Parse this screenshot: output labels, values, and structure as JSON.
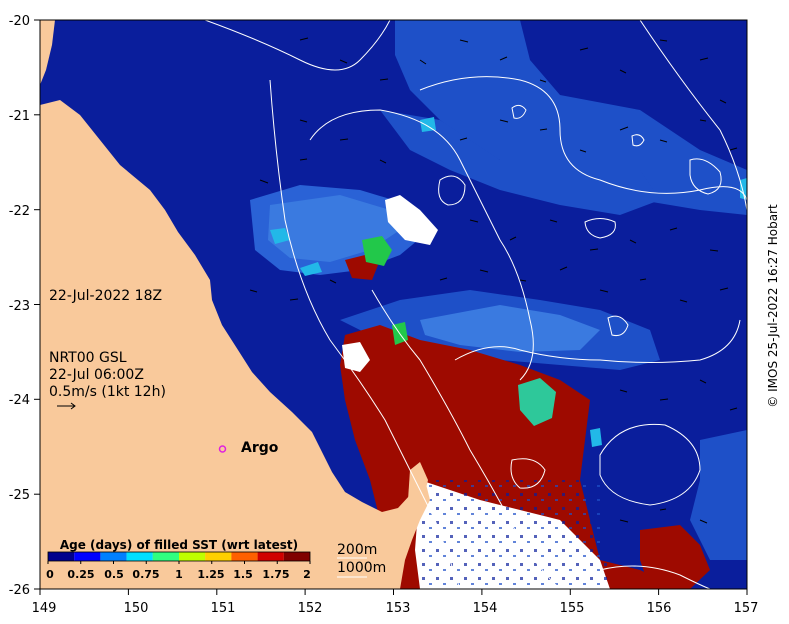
{
  "map": {
    "x_ticks": [
      "149",
      "150",
      "151",
      "152",
      "153",
      "154",
      "155",
      "156",
      "157"
    ],
    "y_ticks": [
      "-20",
      "-21",
      "-22",
      "-23",
      "-24",
      "-25",
      "-26"
    ],
    "lon_range": [
      149,
      157
    ],
    "lat_range": [
      -26,
      -20
    ],
    "colors": {
      "land": "#f9c99b",
      "ocean_deep": "#0a1e9c",
      "ocean_mid": "#1e50c8",
      "ocean_light": "#3a7ae0",
      "cyan": "#22b8e8",
      "warm": "#9e0a00",
      "green": "#22c84a",
      "teal": "#2ec89a",
      "nodata": "#ffffff",
      "contour": "#ffffff"
    }
  },
  "annotations": {
    "datetime": "22-Jul-2022 18Z",
    "model": "NRT00 GSL",
    "model_time": "22-Jul 06:00Z",
    "vector_scale": "0.5m/s (1kt 12h)",
    "argo_label": "Argo",
    "isobath_200": "200m",
    "isobath_1000": "1000m",
    "credit": "© IMOS 25-Jul-2022 16:27 Hobart"
  },
  "colorbar": {
    "title": "Age (days) of filled SST (wrt latest)",
    "ticks": [
      "0",
      "0.25",
      "0.5",
      "0.75",
      "1",
      "1.25",
      "1.5",
      "1.75",
      "2"
    ],
    "range": [
      0,
      2
    ],
    "colors": [
      "#00008c",
      "#0000ff",
      "#0080ff",
      "#00e0ff",
      "#30ff80",
      "#c0ff00",
      "#ffd000",
      "#ff6000",
      "#d00000",
      "#800000"
    ]
  },
  "argo": {
    "lon": 150.98,
    "lat": -24.57,
    "color": "#e020e0"
  }
}
